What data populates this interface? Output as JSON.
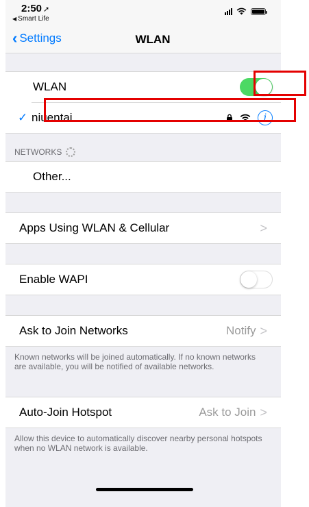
{
  "status_bar": {
    "time": "2:50",
    "location_glyph": "➚",
    "back_app_label": "Smart Life"
  },
  "nav": {
    "back_label": "Settings",
    "title": "WLAN"
  },
  "wlan": {
    "label": "WLAN",
    "enabled": true,
    "connected_network": "niuentai",
    "check_glyph": "✓"
  },
  "networks": {
    "header": "NETWORKS",
    "other_label": "Other..."
  },
  "apps_using": {
    "label": "Apps Using WLAN & Cellular",
    "chevron": ">"
  },
  "wapi": {
    "label": "Enable WAPI",
    "enabled": false
  },
  "ask_to_join": {
    "label": "Ask to Join Networks",
    "value": "Notify",
    "chevron": ">",
    "footnote": "Known networks will be joined automatically. If no known networks are available, you will be notified of available networks."
  },
  "auto_join": {
    "label": "Auto-Join Hotspot",
    "value": "Ask to Join",
    "chevron": ">",
    "footnote": "Allow this device to automatically discover nearby personal hotspots when no WLAN network is available."
  },
  "icons": {
    "info_glyph": "i",
    "lock": "lock-icon",
    "wifi": "wifi-icon"
  },
  "colors": {
    "accent": "#007aff",
    "toggle_on": "#4cd964",
    "annotation": "#e40000"
  }
}
